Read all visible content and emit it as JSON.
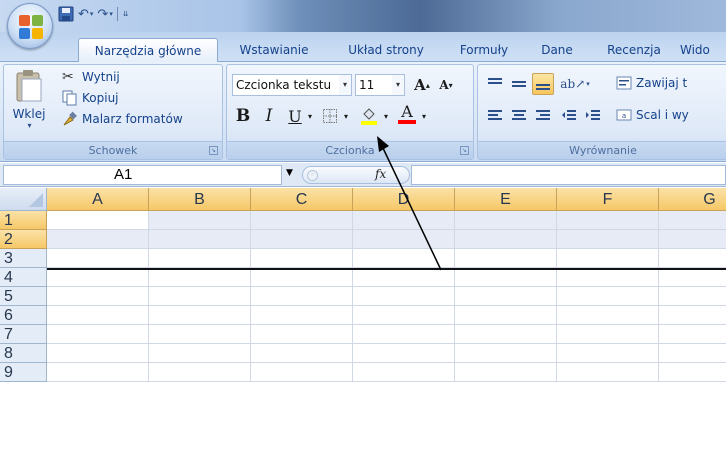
{
  "quick_access": {
    "title_text": ""
  },
  "tabs": [
    {
      "label": "Narzędzia główne",
      "active": true
    },
    {
      "label": "Wstawianie",
      "active": false
    },
    {
      "label": "Układ strony",
      "active": false
    },
    {
      "label": "Formuły",
      "active": false
    },
    {
      "label": "Dane",
      "active": false
    },
    {
      "label": "Recenzja",
      "active": false
    },
    {
      "label": "Wido",
      "active": false
    }
  ],
  "ribbon": {
    "clipboard": {
      "label": "Schowek",
      "paste": "Wklej",
      "cut": "Wytnij",
      "copy": "Kopiuj",
      "format_painter": "Malarz formatów"
    },
    "font": {
      "label": "Czcionka",
      "font_name": "Czcionka tekstu",
      "font_size": "11",
      "bold": "B",
      "italic": "I",
      "underline": "U",
      "grow": "A",
      "shrink": "A",
      "font_color": "A"
    },
    "alignment": {
      "label": "Wyrównanie",
      "wrap_text": "Zawijaj t",
      "merge_center": "Scal i wy"
    }
  },
  "formula_bar": {
    "name_box": "A1",
    "fx": "fx",
    "formula": ""
  },
  "grid": {
    "columns": [
      "A",
      "B",
      "C",
      "D",
      "E",
      "F",
      "G"
    ],
    "rows": [
      "1",
      "2",
      "3",
      "4",
      "5",
      "6",
      "7",
      "8",
      "9"
    ],
    "active_cell": "A1",
    "selected_rows": [
      "1",
      "2"
    ]
  },
  "colors": {
    "ribbon_text": "#15428b",
    "header_highlight": "#f6c867",
    "selection": "#e6ebf5",
    "fill_color_bar": "#ffff00",
    "font_color_bar": "#ff0000"
  }
}
